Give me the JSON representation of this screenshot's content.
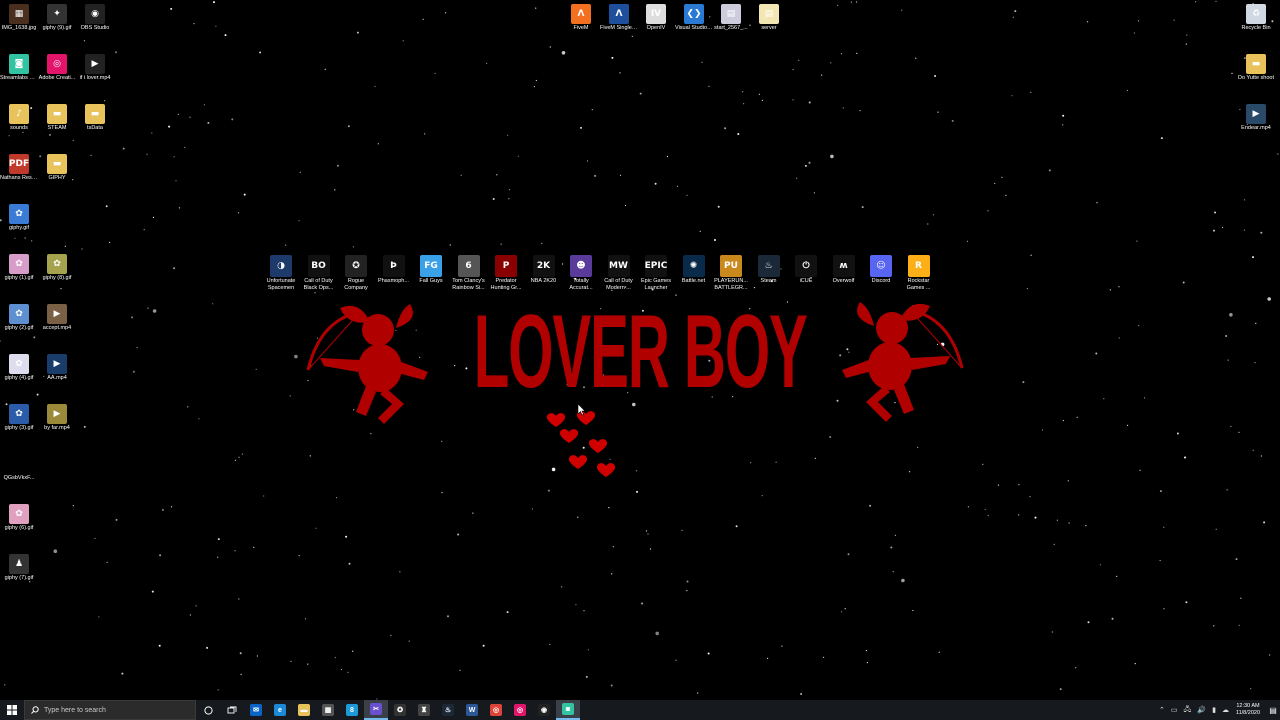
{
  "desktop_left": [
    {
      "name": "img-file",
      "label": "IMG_1638.jpg",
      "color": "#4a2f1e",
      "glyph": "▦"
    },
    {
      "name": "giphy-9",
      "label": "giphy (9).gif",
      "color": "#333",
      "glyph": "✦"
    },
    {
      "name": "obs-studio",
      "label": "OBS Studio",
      "color": "#222",
      "glyph": "◉"
    },
    {
      "name": "streamlabs-obs",
      "label": "Streamlabs OBS",
      "color": "#31c3a2",
      "glyph": "◙"
    },
    {
      "name": "adobe-creative",
      "label": "Adobe Creati...",
      "color": "#e2156b",
      "glyph": "◎"
    },
    {
      "name": "ifi-lover",
      "label": "if i lover.mp4",
      "color": "#222",
      "glyph": "▶"
    },
    {
      "name": "sounds-folder",
      "label": "sounds",
      "color": "#e8c25a",
      "glyph": "♪"
    },
    {
      "name": "steam-folder",
      "label": "STEAM",
      "color": "#e8c25a",
      "glyph": "▬"
    },
    {
      "name": "tsdata",
      "label": "tsData",
      "color": "#e8c25a",
      "glyph": "▬"
    },
    {
      "name": "nathans-resume",
      "label": "Nathans Resum...",
      "color": "#c0392b",
      "glyph": "PDF"
    },
    {
      "name": "giphy-folder",
      "label": "GIPHY",
      "color": "#e8c25a",
      "glyph": "▬"
    },
    {
      "name": "giphy-gif",
      "label": "giphy.gif",
      "color": "#3a7bd5",
      "glyph": "✿"
    },
    {
      "name": "giphy-1",
      "label": "giphy (1).gif",
      "color": "#d89cc9",
      "glyph": "✿"
    },
    {
      "name": "giphy-8",
      "label": "giphy (8).gif",
      "color": "#a6a34f",
      "glyph": "✿"
    },
    {
      "name": "giphy-2",
      "label": "giphy (2).gif",
      "color": "#5d8fd1",
      "glyph": "✿"
    },
    {
      "name": "accept-mp4",
      "label": "accept.mp4",
      "color": "#7a6045",
      "glyph": "▶"
    },
    {
      "name": "giphy-4",
      "label": "giphy (4).gif",
      "color": "#dde",
      "glyph": "✿"
    },
    {
      "name": "aa-mp4",
      "label": "AA.mp4",
      "color": "#1a3c6a",
      "glyph": "▶"
    },
    {
      "name": "giphy-3",
      "label": "giphy (3).gif",
      "color": "#2a5caa",
      "glyph": "✿"
    },
    {
      "name": "by-far-mp4",
      "label": "by far.mp4",
      "color": "#9a8a3a",
      "glyph": "▶"
    },
    {
      "name": "qgsb-file",
      "label": "QGsbVkxF...",
      "color": "#000",
      "glyph": ""
    },
    {
      "name": "giphy-6",
      "label": "giphy (6).gif",
      "color": "#e0a0c0",
      "glyph": "✿"
    },
    {
      "name": "giphy-7",
      "label": "giphy (7).gif",
      "color": "#333",
      "glyph": "♟"
    }
  ],
  "desktop_top": [
    {
      "name": "fivem",
      "label": "FiveM",
      "color": "#f37021",
      "glyph": "Λ"
    },
    {
      "name": "fivem-singleplayer",
      "label": "FiveM Singleplayer",
      "color": "#1e4f9c",
      "glyph": "Λ"
    },
    {
      "name": "openiv",
      "label": "OpenIV",
      "color": "#ddd",
      "glyph": "IV"
    },
    {
      "name": "visual-studio-code",
      "label": "Visual Studio Code",
      "color": "#2a7ad3",
      "glyph": "❮❯"
    },
    {
      "name": "start-file",
      "label": "start_2567_...",
      "color": "#ccd",
      "glyph": "▤"
    },
    {
      "name": "server-file",
      "label": "server",
      "color": "#f2e6b3",
      "glyph": "▤"
    }
  ],
  "desktop_right": [
    {
      "name": "recycle-bin",
      "label": "Recycle Bin",
      "color": "#cfd8e3",
      "glyph": "♻"
    },
    {
      "name": "do-yute-shoot",
      "label": "Do Yutte shoot",
      "color": "#e8c25a",
      "glyph": "▬"
    },
    {
      "name": "endear-mp4",
      "label": "Endear.mp4",
      "color": "#2a4a6a",
      "glyph": "▶"
    }
  ],
  "game_icons": [
    {
      "name": "unfortunate-spacemen",
      "label": "Unfortunate Spacemen",
      "color": "#1d3a6a",
      "glyph": "◑"
    },
    {
      "name": "call-of-duty-bo",
      "label": "Call of Duty Black Ops...",
      "color": "#111",
      "glyph": "BO"
    },
    {
      "name": "rogue-company",
      "label": "Rogue Company",
      "color": "#222",
      "glyph": "✪"
    },
    {
      "name": "phasmophobia",
      "label": "Phasmoph...",
      "color": "#111",
      "glyph": "Ϸ"
    },
    {
      "name": "fall-guys",
      "label": "Fall Guys",
      "color": "#3aa0e8",
      "glyph": "FG"
    },
    {
      "name": "rainbow-six",
      "label": "Tom Clancy's Rainbow Si...",
      "color": "#555",
      "glyph": "6"
    },
    {
      "name": "predator",
      "label": "Predator Hunting Gr...",
      "color": "#8a0000",
      "glyph": "P"
    },
    {
      "name": "nba-2k20",
      "label": "NBA 2K20",
      "color": "#111",
      "glyph": "2K"
    },
    {
      "name": "totally-accurate",
      "label": "Totally Accurat...",
      "color": "#5a3a9a",
      "glyph": "☻"
    },
    {
      "name": "cod-modern",
      "label": "Call of Duty Modern ...",
      "color": "#111",
      "glyph": "MW"
    },
    {
      "name": "epic-games",
      "label": "Epic Games Launcher",
      "color": "#111",
      "glyph": "EPIC"
    },
    {
      "name": "battle-net",
      "label": "Battle.net",
      "color": "#0a2a4a",
      "glyph": "✺"
    },
    {
      "name": "pubg",
      "label": "PLAYERUN... BATTLEGR...",
      "color": "#c9891c",
      "glyph": "PU"
    },
    {
      "name": "steam",
      "label": "Steam",
      "color": "#1b2838",
      "glyph": "♨"
    },
    {
      "name": "icue",
      "label": "iCUE",
      "color": "#111",
      "glyph": "⏻"
    },
    {
      "name": "overwolf",
      "label": "Overwolf",
      "color": "#111",
      "glyph": "ʍ"
    },
    {
      "name": "discord",
      "label": "Discord",
      "color": "#5865f2",
      "glyph": "☺"
    },
    {
      "name": "rockstar",
      "label": "Rockstar Games ...",
      "color": "#fcaf17",
      "glyph": "R"
    }
  ],
  "wallpaper": {
    "title": "LOVER BOY"
  },
  "taskbar": {
    "search_placeholder": "Type here to search",
    "pins": [
      {
        "name": "mail",
        "color": "#0a64c8",
        "glyph": "✉"
      },
      {
        "name": "edge",
        "color": "#1a8ad8",
        "glyph": "e"
      },
      {
        "name": "file-explorer",
        "color": "#e8c25a",
        "glyph": "▬"
      },
      {
        "name": "store",
        "color": "#555",
        "glyph": "▦"
      },
      {
        "name": "8-app",
        "color": "#1d9bd8",
        "glyph": "8"
      },
      {
        "name": "snip",
        "color": "#6a4fcf",
        "glyph": "✂"
      },
      {
        "name": "xbox",
        "color": "#333",
        "glyph": "✪"
      },
      {
        "name": "game-bar",
        "color": "#444",
        "glyph": "♜"
      },
      {
        "name": "steam-pin",
        "color": "#1b2838",
        "glyph": "♨"
      },
      {
        "name": "word",
        "color": "#2b5797",
        "glyph": "W"
      },
      {
        "name": "chrome",
        "color": "#db4437",
        "glyph": "◎"
      },
      {
        "name": "adobe-pin",
        "color": "#e2156b",
        "glyph": "◎"
      },
      {
        "name": "obs-pin",
        "color": "#222",
        "glyph": "◉"
      },
      {
        "name": "streamlabs-pin",
        "color": "#31c3a2",
        "glyph": "◙"
      }
    ],
    "time": "12:30 AM",
    "date": "11/8/2020"
  }
}
